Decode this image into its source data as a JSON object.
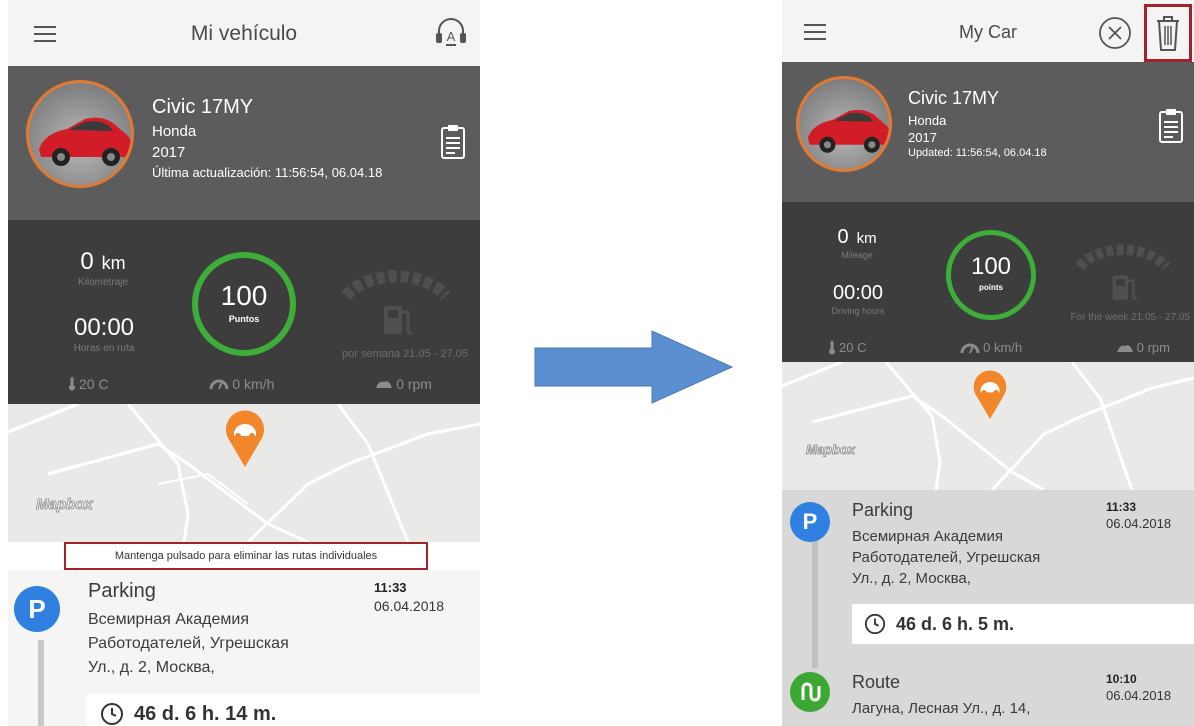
{
  "left": {
    "title": "Mi vehículo",
    "car": {
      "model": "Civic 17MY",
      "brand": "Honda",
      "year": "2017",
      "updated": "Última actualización: 11:56:54, 06.04.18"
    },
    "stats": {
      "mileage_value": "0",
      "mileage_unit": "km",
      "mileage_label": "Kilometraje",
      "hours_value": "00:00",
      "hours_label": "Horas en ruta",
      "points_value": "100",
      "points_label": "Puntos",
      "week_text": "por semana 21.05 - 27.05",
      "temperature": "20 C",
      "speed": "0 km/h",
      "rpm": "0 rpm"
    },
    "map_logo": "Mapbox",
    "hint": "Mantenga pulsado para eliminar las rutas individuales",
    "entry": {
      "title": "Parking",
      "address_lines": [
        "Всемирная Академия",
        "Работодателей, Угрешская",
        "Ул., д. 2, Москва,"
      ],
      "time": "11:33",
      "date": "06.04.2018",
      "duration": "46 d. 6 h. 14 m."
    }
  },
  "right": {
    "title": "My Car",
    "car": {
      "model": "Civic 17MY",
      "brand": "Honda",
      "year": "2017",
      "updated": "Updated: 11:56:54, 06.04.18"
    },
    "stats": {
      "mileage_value": "0",
      "mileage_unit": "km",
      "mileage_label": "Mileage",
      "hours_value": "00:00",
      "hours_label": "Driving hours",
      "points_value": "100",
      "points_label": "points",
      "week_text": "For the week 21.05 - 27.05",
      "temperature": "20 C",
      "speed": "0 km/h",
      "rpm": "0 rpm"
    },
    "map_logo": "Mapbox",
    "entries": [
      {
        "title": "Parking",
        "address_lines": [
          "Всемирная Академия",
          "Работодателей, Угрешская",
          "Ул., д. 2, Москва,"
        ],
        "time": "11:33",
        "date": "06.04.2018",
        "duration": "46 d. 6 h. 5 m."
      },
      {
        "title": "Route",
        "address_lines": [
          "Лагуна, Лесная Ул., д. 14,"
        ],
        "time": "10:10",
        "date": "06.04.2018"
      }
    ]
  },
  "colors": {
    "accent_green": "#3fad3a",
    "highlight_red": "#a3232a",
    "arrow_blue": "#5b8fd0",
    "parking_blue": "#2f80e0",
    "route_green": "#3aa832",
    "pin_orange": "#f1862a"
  },
  "icons": {
    "menu": "hamburger-icon",
    "help": "headset-icon",
    "close": "close-circle-icon",
    "delete": "trash-icon",
    "document": "clipboard-icon",
    "temperature": "thermometer-icon",
    "speed": "speedometer-icon",
    "rpm": "engine-icon",
    "fuel": "fuel-gauge-icon",
    "location": "car-pin-icon",
    "clock": "clock-icon",
    "parking": "parking-icon",
    "route": "route-icon"
  }
}
